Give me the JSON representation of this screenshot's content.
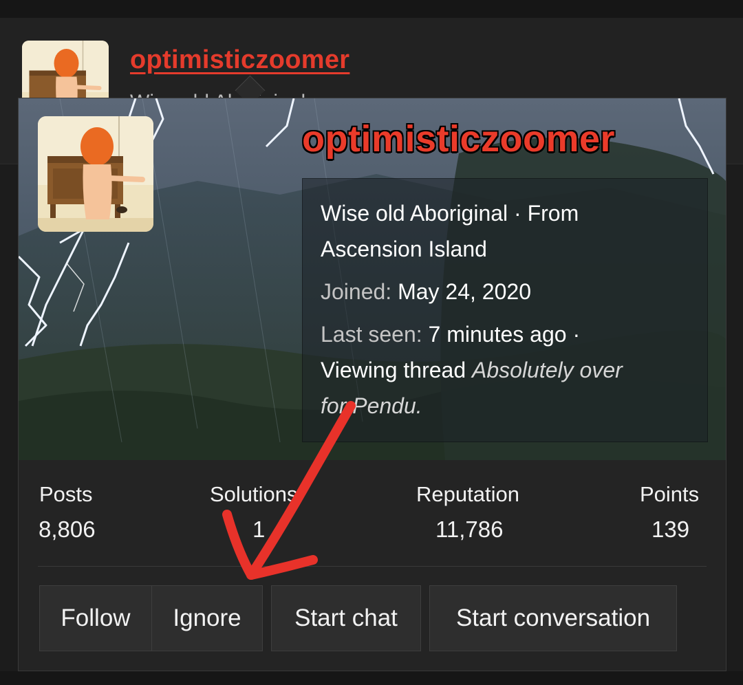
{
  "background_post": {
    "username": "optimisticzoomer",
    "peek_text": "Wise old Aboriginal"
  },
  "card": {
    "username": "optimisticzoomer",
    "title_line": "Wise old Aboriginal · From",
    "title_line2": "Ascension Island",
    "joined_label": "Joined:",
    "joined_value": "May 24, 2020",
    "last_seen_label": "Last seen:",
    "last_seen_value": "7 minutes ago ·",
    "activity_prefix": "Viewing thread",
    "activity_thread_1": "Absolutely over",
    "activity_thread_2": "for Pendu."
  },
  "stats": [
    {
      "label": "Posts",
      "value": "8,806"
    },
    {
      "label": "Solutions",
      "value": "1"
    },
    {
      "label": "Reputation",
      "value": "11,786"
    },
    {
      "label": "Points",
      "value": "139"
    }
  ],
  "buttons": {
    "follow": "Follow",
    "ignore": "Ignore",
    "start_chat": "Start chat",
    "start_conversation": "Start conversation"
  },
  "colors": {
    "username": "#ea3b2a",
    "annotation_arrow": "#e8322a",
    "background": "#1c1c1c"
  }
}
